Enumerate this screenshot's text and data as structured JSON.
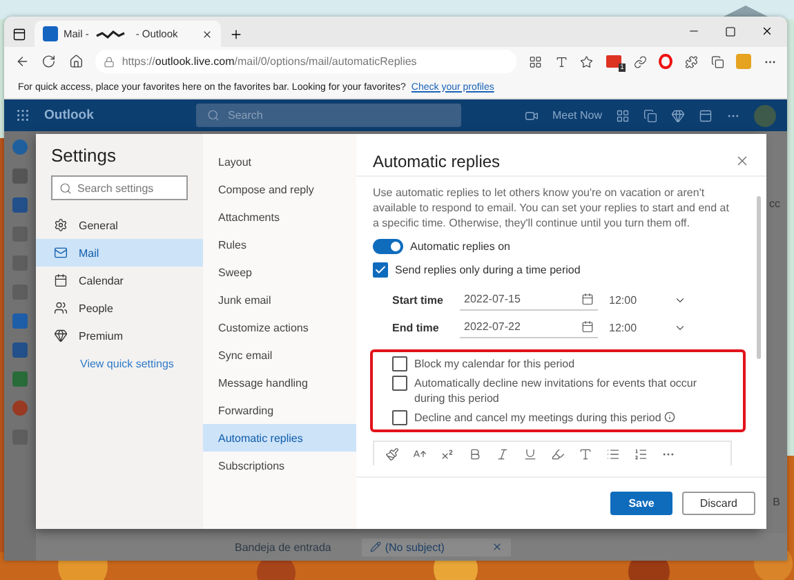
{
  "browser": {
    "tab": {
      "title_start": "Mail -",
      "title_end": "- Outlook"
    },
    "url": {
      "scheme": "https://",
      "host": "outlook.live.com",
      "path": "/mail/0/options/mail/automaticReplies"
    },
    "extension_badge": "1",
    "favorites_bar": {
      "message": "For quick access, place your favorites here on the favorites bar. Looking for your favorites?",
      "link": "Check your profiles"
    }
  },
  "outlook_header": {
    "app_name": "Outlook",
    "search_placeholder": "Search",
    "meet_now": "Meet Now"
  },
  "settings": {
    "title": "Settings",
    "search_placeholder": "Search settings",
    "categories": [
      {
        "label": "General",
        "kind": "gear",
        "selected": false
      },
      {
        "label": "Mail",
        "kind": "mail",
        "selected": true
      },
      {
        "label": "Calendar",
        "kind": "calendar",
        "selected": false
      },
      {
        "label": "People",
        "kind": "people",
        "selected": false
      },
      {
        "label": "Premium",
        "kind": "diamond",
        "selected": false
      }
    ],
    "quick_settings_link": "View quick settings",
    "sections": [
      {
        "label": "Layout",
        "selected": false
      },
      {
        "label": "Compose and reply",
        "selected": false
      },
      {
        "label": "Attachments",
        "selected": false
      },
      {
        "label": "Rules",
        "selected": false
      },
      {
        "label": "Sweep",
        "selected": false
      },
      {
        "label": "Junk email",
        "selected": false
      },
      {
        "label": "Customize actions",
        "selected": false
      },
      {
        "label": "Sync email",
        "selected": false
      },
      {
        "label": "Message handling",
        "selected": false
      },
      {
        "label": "Forwarding",
        "selected": false
      },
      {
        "label": "Automatic replies",
        "selected": true
      },
      {
        "label": "Subscriptions",
        "selected": false
      }
    ]
  },
  "automatic_replies": {
    "title": "Automatic replies",
    "description": "Use automatic replies to let others know you're on vacation or aren't available to respond to email. You can set your replies to start and end at a specific time. Otherwise, they'll continue until you turn them off.",
    "replies_toggle": {
      "label": "Automatic replies on",
      "on": true
    },
    "time_period": {
      "label": "Send replies only during a time period",
      "checked": true
    },
    "period_rows": [
      {
        "label": "Start time",
        "date": "2022-07-15",
        "time": "12:00"
      },
      {
        "label": "End time",
        "date": "2022-07-22",
        "time": "12:00"
      }
    ],
    "options": [
      {
        "label": "Block my calendar for this period",
        "checked": false
      },
      {
        "label": "Automatically decline new invitations for events that occur during this period",
        "checked": false
      },
      {
        "label": "Decline and cancel my meetings during this period",
        "checked": false,
        "info": true
      }
    ],
    "buttons": {
      "save": "Save",
      "discard": "Discard"
    }
  },
  "background_list": {
    "folder": "Bandeja de entrada",
    "draft": "(No subject)",
    "fragments": [
      "cc",
      "B"
    ]
  }
}
